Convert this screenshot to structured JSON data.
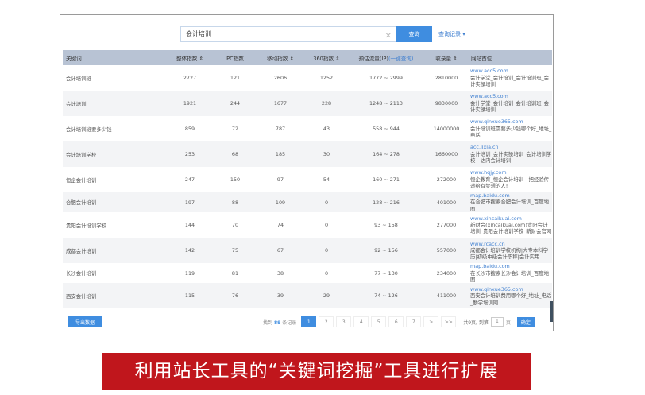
{
  "search": {
    "value": "会计培训",
    "button": "查询",
    "history": "查询记录 ▾"
  },
  "columns": [
    "关键词",
    "整体指数 ⇕",
    "PC指数",
    "移动指数 ⇕",
    "360指数 ⇕",
    "预估流量(IP)",
    "(一键查询)",
    "收录量 ⇕",
    "网站首位"
  ],
  "rows": [
    {
      "kw": "会计培训班",
      "a": "2727",
      "b": "121",
      "c": "2606",
      "d": "1252",
      "e": "1772 ~ 2999",
      "f": "2810000",
      "domain": "www.acc5.com",
      "desc": "会计学堂_会计培训_会计培训班_会计实操培训"
    },
    {
      "kw": "会计培训",
      "a": "1921",
      "b": "244",
      "c": "1677",
      "d": "228",
      "e": "1248 ~ 2113",
      "f": "9830000",
      "domain": "www.acc5.com",
      "desc": "会计学堂_会计培训_会计培训班_会计实操培训"
    },
    {
      "kw": "会计培训班要多少钱",
      "a": "859",
      "b": "72",
      "c": "787",
      "d": "43",
      "e": "558 ~ 944",
      "f": "14000000",
      "domain": "www.qinxue365.com",
      "desc": "会计培训班需要多少钱哪个好_地址_电话"
    },
    {
      "kw": "会计培训学校",
      "a": "253",
      "b": "68",
      "c": "185",
      "d": "30",
      "e": "164 ~ 278",
      "f": "1660000",
      "domain": "acc.lixia.cn",
      "desc": "会计培训_会计实操培训_会计培训学校 - 达内会计培训"
    },
    {
      "kw": "恒企会计培训",
      "a": "247",
      "b": "150",
      "c": "97",
      "d": "54",
      "e": "160 ~ 271",
      "f": "272000",
      "domain": "www.hqjy.com",
      "desc": "恒企教育_恒企会计培训 - 把经验传递给有梦想的人!"
    },
    {
      "kw": "合肥会计培训",
      "a": "197",
      "b": "88",
      "c": "109",
      "d": "0",
      "e": "128 ~ 216",
      "f": "401000",
      "domain": "map.baidu.com",
      "desc": "在合肥市搜索合肥会计培训_百度地图"
    },
    {
      "kw": "贵阳会计培训学校",
      "a": "144",
      "b": "70",
      "c": "74",
      "d": "0",
      "e": "93 ~ 158",
      "f": "277000",
      "domain": "www.xincaikuai.com",
      "desc": "新财会(xincaikuai.com)贵阳会计培训_贵阳会计培训学校_新财会官网"
    },
    {
      "kw": "成都会计培训",
      "a": "142",
      "b": "75",
      "c": "67",
      "d": "0",
      "e": "92 ~ 156",
      "f": "557000",
      "domain": "www.rcacc.cn",
      "desc": "成都会计培训学校机构|大专本科学历|初级中级会计职称|会计实用..."
    },
    {
      "kw": "长沙会计培训",
      "a": "119",
      "b": "81",
      "c": "38",
      "d": "0",
      "e": "77 ~ 130",
      "f": "234000",
      "domain": "map.baidu.com",
      "desc": "在长沙市搜索长沙会计培训_百度地图"
    },
    {
      "kw": "西安会计培训",
      "a": "115",
      "b": "76",
      "c": "39",
      "d": "29",
      "e": "74 ~ 126",
      "f": "411000",
      "domain": "www.qinxue365.com",
      "desc": "西安会计培训费用哪个好_地址_电话_勤学培训网"
    }
  ],
  "footer": {
    "export": "导出数据",
    "total_pre": "找到",
    "total_num": "89",
    "total_post": "条记录",
    "pages": [
      "1",
      "2",
      "3",
      "4",
      "5",
      "6",
      "7",
      ">",
      ">>"
    ],
    "pages_info": "共9页, 到第",
    "goto_value": "1",
    "page_unit": "页",
    "ok": "确定"
  },
  "caption": "利用站长工具的“关键词挖掘”工具进行扩展",
  "colors": {
    "accent": "#3f8de0",
    "header": "#b8c3d4",
    "caption_bg": "#c0161c"
  }
}
